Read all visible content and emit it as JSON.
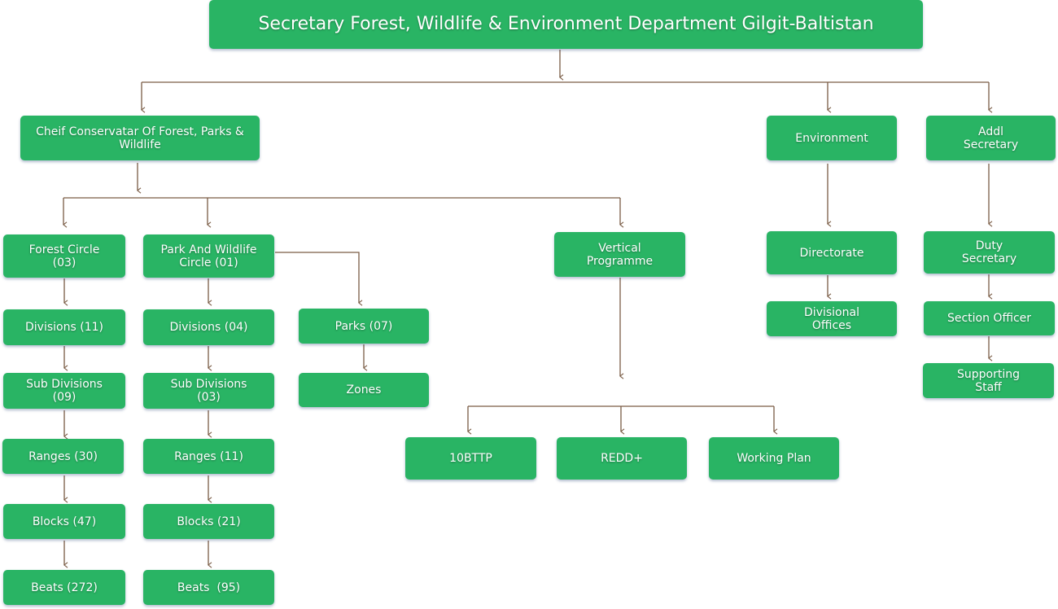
{
  "diagram": {
    "line_color": "#7a5c45",
    "node_color": "#29b464",
    "nodes": {
      "secretary": "Secretary Forest, Wildlife & Environment Department Gilgit-Baltistan",
      "chief_conservator": "Cheif Conservatar Of Forest, Parks & Wildlife",
      "environment": "Environment",
      "addl_secretary": "Addl Secretary",
      "forest_circle": "Forest Circle (03)",
      "park_wildlife_circle": "Park And Wildlife Circle (01)",
      "vertical_programme": "Vertical Programme",
      "directorate": "Directorate",
      "duty_secretary": "Duty Secretary",
      "fc_divisions": "Divisions (11)",
      "pw_divisions": "Divisions (04)",
      "parks": "Parks (07)",
      "divisional_offices": "Divisional Offices",
      "section_officer": "Section Officer",
      "fc_sub_divisions": "Sub Divisions (09)",
      "pw_sub_divisions": "Sub Divisions (03)",
      "zones": "Zones",
      "supporting_staff": "Supporting Staff",
      "fc_ranges": "Ranges (30)",
      "pw_ranges": "Ranges (11)",
      "tbttp": "10BTTP",
      "redd": "REDD+",
      "working_plan": "Working Plan",
      "fc_blocks": "Blocks (47)",
      "pw_blocks": "Blocks (21)",
      "fc_beats": "Beats (272)",
      "pw_beats": "Beats  (95)"
    }
  }
}
